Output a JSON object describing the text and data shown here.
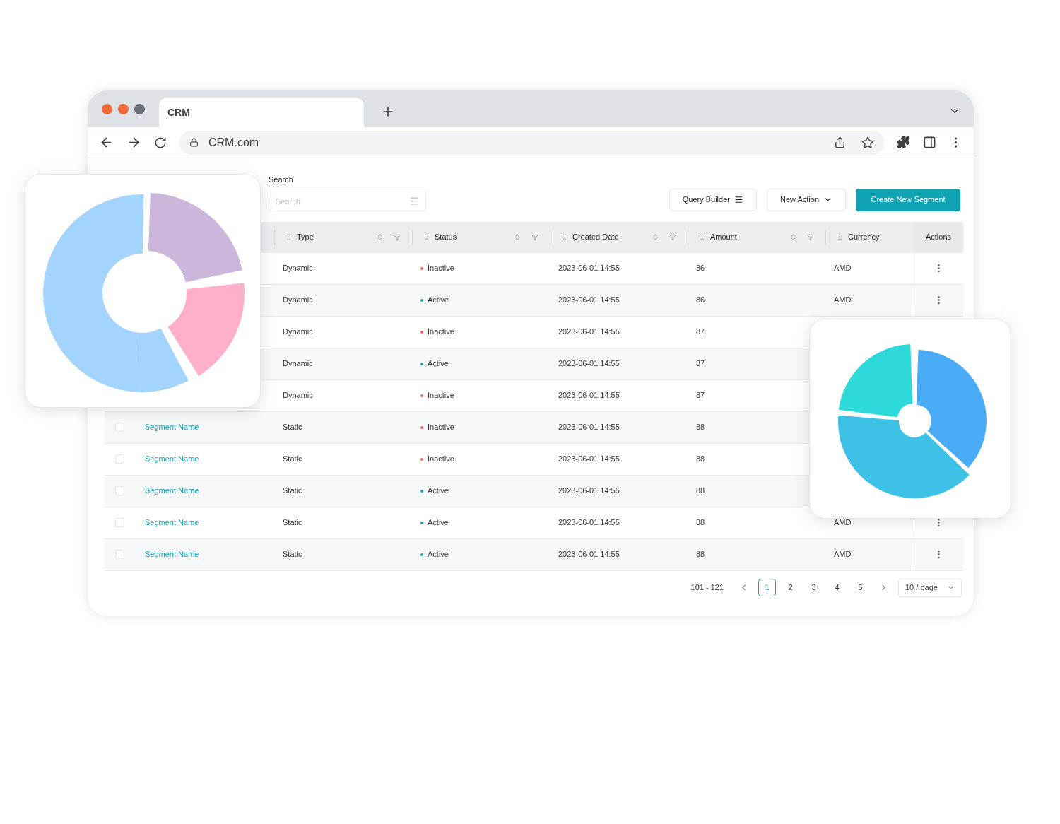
{
  "browser": {
    "tab_title": "CRM",
    "url": "CRM.com"
  },
  "search": {
    "label": "Search",
    "placeholder": "Search"
  },
  "toolbar": {
    "query_builder": "Query Builder",
    "new_action": "New Action",
    "create": "Create New Segment"
  },
  "table": {
    "columns": [
      {
        "label": "Type",
        "sortable": true,
        "filterable": true
      },
      {
        "label": "Status",
        "sortable": true,
        "filterable": true
      },
      {
        "label": "Created Date",
        "sortable": true,
        "filterable": true
      },
      {
        "label": "Amount",
        "sortable": true,
        "filterable": true
      },
      {
        "label": "Currency",
        "sortable": false,
        "filterable": false
      }
    ],
    "actions_header": "Actions",
    "rows": [
      {
        "type": "Dynamic",
        "status": "Inactive",
        "color": "#f26b4e",
        "created": "2023-06-01 14:55",
        "amount": "86",
        "currency": "AMD",
        "actions_menu": true
      },
      {
        "type": "Dynamic",
        "status": "Active",
        "color": "#12a4b8",
        "created": "2023-06-01 14:55",
        "amount": "86",
        "currency": "AMD",
        "actions_menu": true
      },
      {
        "type": "Dynamic",
        "status": "Inactive",
        "color": "#f26b4e",
        "created": "2023-06-01 14:55",
        "amount": "87"
      },
      {
        "type": "Dynamic",
        "status": "Active",
        "color": "#12a4b8",
        "created": "2023-06-01 14:55",
        "amount": "87"
      },
      {
        "type": "Dynamic",
        "status": "Inactive",
        "color": "#f26b4e",
        "created": "2023-06-01 14:55",
        "amount": "87"
      },
      {
        "checked": false,
        "name": "Segment Name",
        "type": "Static",
        "status": "Inactive",
        "color": "#f26b4e",
        "created": "2023-06-01 14:55",
        "amount": "88"
      },
      {
        "checked": false,
        "name": "Segment Name",
        "type": "Static",
        "status": "Inactive",
        "color": "#f26b4e",
        "created": "2023-06-01 14:55",
        "amount": "88"
      },
      {
        "checked": false,
        "name": "Segment Name",
        "type": "Static",
        "status": "Active",
        "color": "#12a4b8",
        "created": "2023-06-01 14:55",
        "amount": "88"
      },
      {
        "checked": false,
        "name": "Segment Name",
        "type": "Static",
        "status": "Active",
        "color": "#12a4b8",
        "created": "2023-06-01 14:55",
        "amount": "88",
        "currency": "AMD",
        "actions_menu": true
      },
      {
        "checked": false,
        "name": "Segment Name",
        "type": "Static",
        "status": "Active",
        "color": "#12a4b8",
        "created": "2023-06-01 14:55",
        "amount": "88",
        "currency": "AMD",
        "actions_menu": true
      }
    ]
  },
  "pagination": {
    "range": "101 - 121",
    "pages": [
      {
        "label": "1",
        "selected": true
      },
      {
        "label": "2",
        "selected": false
      },
      {
        "label": "3",
        "selected": false
      },
      {
        "label": "4",
        "selected": false
      },
      {
        "label": "5",
        "selected": false
      }
    ],
    "page_size": "10 / page"
  }
}
